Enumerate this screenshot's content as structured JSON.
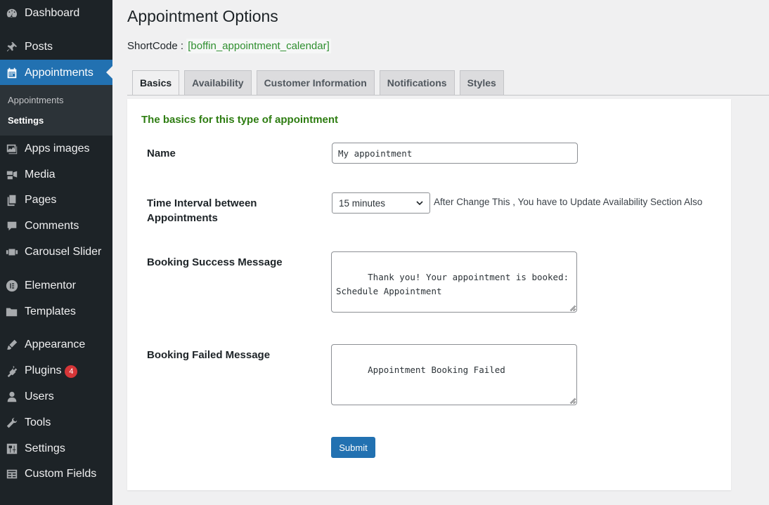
{
  "sidebar": {
    "items": [
      {
        "label": "Dashboard",
        "icon": "dashboard-icon"
      },
      {
        "label": "Posts",
        "icon": "pin-icon"
      },
      {
        "label": "Appointments",
        "icon": "calendar-icon"
      },
      {
        "label": "Apps images",
        "icon": "images-icon"
      },
      {
        "label": "Media",
        "icon": "media-icon"
      },
      {
        "label": "Pages",
        "icon": "pages-icon"
      },
      {
        "label": "Comments",
        "icon": "comments-icon"
      },
      {
        "label": "Carousel Slider",
        "icon": "slider-icon"
      },
      {
        "label": "Elementor",
        "icon": "elementor-icon"
      },
      {
        "label": "Templates",
        "icon": "folder-icon"
      },
      {
        "label": "Appearance",
        "icon": "brush-icon"
      },
      {
        "label": "Plugins",
        "icon": "plug-icon",
        "badge": "4"
      },
      {
        "label": "Users",
        "icon": "user-icon"
      },
      {
        "label": "Tools",
        "icon": "wrench-icon"
      },
      {
        "label": "Settings",
        "icon": "settings-icon"
      },
      {
        "label": "Custom Fields",
        "icon": "table-icon"
      }
    ],
    "submenu": [
      "Appointments",
      "Settings"
    ],
    "colors": {
      "background": "#1d2327",
      "active": "#2271b1",
      "submenu": "#2c3338"
    }
  },
  "page": {
    "title": "Appointment Options",
    "shortcode_label": "ShortCode",
    "shortcode_sep": ":",
    "shortcode_value": "[boffin_appointment_calendar]"
  },
  "tabs": [
    "Basics",
    "Availability",
    "Customer Information",
    "Notifications",
    "Styles"
  ],
  "form": {
    "heading": "The basics for this type of appointment",
    "name_label": "Name",
    "name_value": "My appointment",
    "interval_label": "Time Interval between Appointments",
    "interval_value": "15 minutes",
    "interval_help": "After Change This , You have to Update Availability Section Also",
    "success_label": "Booking Success Message",
    "success_value": "Thank you! Your appointment is booked:\nSchedule Appointment",
    "failed_label": "Booking Failed Message",
    "failed_value": "Appointment Booking Failed",
    "submit_label": "Submit"
  }
}
